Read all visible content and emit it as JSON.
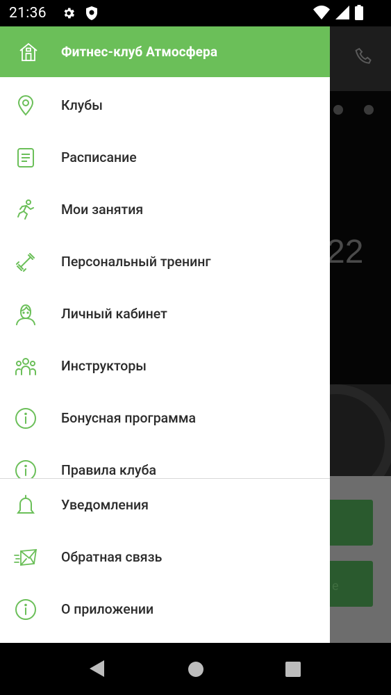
{
  "status_bar": {
    "time": "21:36",
    "icons": [
      "settings-icon",
      "shield-icon",
      "wifi-icon",
      "signal-icon",
      "battery-icon"
    ]
  },
  "drawer": {
    "header": {
      "icon": "home-icon",
      "title": "Фитнес-клуб Атмосфера"
    },
    "items": [
      {
        "icon": "location-pin-icon",
        "label": "Клубы"
      },
      {
        "icon": "document-icon",
        "label": "Расписание"
      },
      {
        "icon": "runner-icon",
        "label": "Мои занятия"
      },
      {
        "icon": "dumbbell-icon",
        "label": "Персональный тренинг"
      },
      {
        "icon": "person-icon",
        "label": "Личный кабинет"
      },
      {
        "icon": "group-icon",
        "label": "Инструкторы"
      },
      {
        "icon": "info-icon",
        "label": "Бонусная программа"
      },
      {
        "icon": "info-icon",
        "label": "Правила клуба"
      }
    ],
    "bottom_items": [
      {
        "icon": "bell-icon",
        "label": "Уведомления"
      },
      {
        "icon": "mail-icon",
        "label": "Обратная связь"
      },
      {
        "icon": "info-icon",
        "label": "О приложении"
      }
    ]
  },
  "background": {
    "banner_text": "22",
    "button_text": "е"
  },
  "nav_bar": {
    "buttons": [
      "back-icon",
      "home-circle-icon",
      "recents-icon"
    ]
  },
  "colors": {
    "accent": "#6bbf59",
    "icon_green": "#6bbf59",
    "text": "#2b2b2b"
  }
}
